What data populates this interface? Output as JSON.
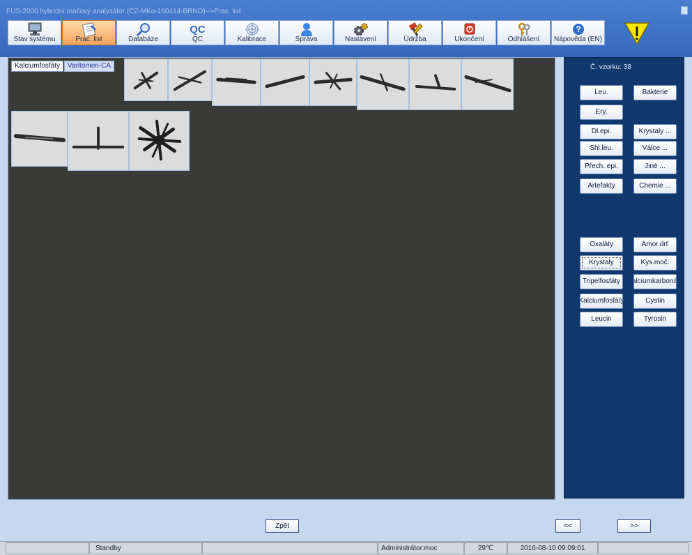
{
  "window": {
    "title": "FUS-2000 hybridní močový analyzátor (CZ-MKo-160414-BRNO)-->Prac. list"
  },
  "toolbar": [
    {
      "name": "stav-systemu",
      "label": "Stav systému",
      "icon": "monitor-icon"
    },
    {
      "name": "prac-list",
      "label": "Prac. list",
      "icon": "worksheet-icon",
      "active": true
    },
    {
      "name": "databaze",
      "label": "Databáze",
      "icon": "magnifier-icon"
    },
    {
      "name": "qc",
      "label": "QC",
      "icon": "qc-icon",
      "icon_text": "QC"
    },
    {
      "name": "kalibrace",
      "label": "Kalibrace",
      "icon": "target-icon"
    },
    {
      "name": "sprava",
      "label": "Správa",
      "icon": "user-icon"
    },
    {
      "name": "nastaveni",
      "label": "Nastavení",
      "icon": "gears-icon"
    },
    {
      "name": "udrzba",
      "label": "Údržba",
      "icon": "tools-icon"
    },
    {
      "name": "ukonceni",
      "label": "Ukončení",
      "icon": "power-icon"
    },
    {
      "name": "odhlaseni",
      "label": "Odhlášení",
      "icon": "keys-icon"
    },
    {
      "name": "napoveda",
      "label": "Nápověda (EN)",
      "icon": "help-icon"
    }
  ],
  "main": {
    "tabs": [
      {
        "label": "Kalciumfosfáty",
        "active": true
      },
      {
        "label": "Varitomen-CA"
      }
    ]
  },
  "right_panel": {
    "sample_label": "Č. vzorku: 38",
    "buttons_top": [
      {
        "label": "Leu."
      },
      {
        "label": "Bakterie"
      },
      {
        "label": "Ery."
      },
      {
        "label": "Dl.epi."
      },
      {
        "label": "Krystaly ..."
      },
      {
        "label": "Shl.leu."
      },
      {
        "label": "Válce ..."
      },
      {
        "label": "Přech. epi."
      },
      {
        "label": "Jiné ..."
      },
      {
        "label": "Artefakty"
      },
      {
        "label": "Chemie ..."
      }
    ],
    "buttons_bottom": [
      {
        "label": "Oxaláty"
      },
      {
        "label": "Amor.drť"
      },
      {
        "label": "Krystaly",
        "focused": true
      },
      {
        "label": "Kys.moč."
      },
      {
        "label": "Tripelfosfáty"
      },
      {
        "label": "Kalciumkarbonáty"
      },
      {
        "label": "Kalciumfosfáty"
      },
      {
        "label": "Cystin"
      },
      {
        "label": "Leucin"
      },
      {
        "label": "Tyrosin"
      }
    ]
  },
  "nav": {
    "back": "Zpět",
    "prev": "<<",
    "next": ">>"
  },
  "status_bar": {
    "state": "Standby",
    "user": "Administrátor:moc",
    "temperature": "29℃",
    "datetime": "2016-08-10 09:09:01"
  },
  "colors": {
    "accent": "#f6a45c",
    "panel": "#10386d",
    "titlebar": "#3568bd",
    "warning": "#ffe600"
  }
}
